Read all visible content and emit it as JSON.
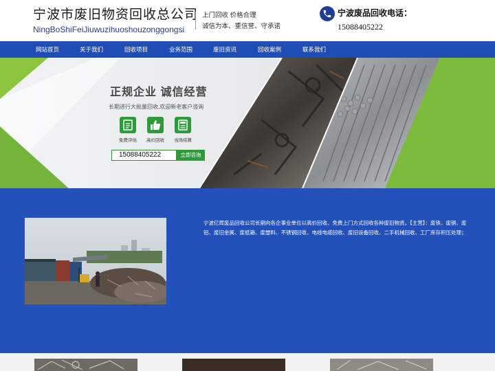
{
  "header": {
    "company_name": "宁波市废旧物资回收总公司",
    "company_pinyin": "NingBoShiFeiJiuwuzihuoshouzonggongsi",
    "slogan_line1": "上门回收 价格合理",
    "slogan_line2": "诚信为本、重信誉、守承诺",
    "hotline_label": "宁波废品回收电话：",
    "hotline_number": "15088405222"
  },
  "nav": {
    "items": [
      {
        "label": "网站首页"
      },
      {
        "label": "关于我们"
      },
      {
        "label": "回收项目"
      },
      {
        "label": "业务范围"
      },
      {
        "label": "废旧资讯"
      },
      {
        "label": "回收案例"
      },
      {
        "label": "联系我们"
      }
    ]
  },
  "banner": {
    "heading": "正规企业  诚信经营",
    "subheading": "长期进行大批量回收,欢迎新老客户咨询",
    "features": [
      {
        "label": "免费评估",
        "icon": "clipboard-icon"
      },
      {
        "label": "高价回收",
        "icon": "thumbs-up-icon"
      },
      {
        "label": "当场结算",
        "icon": "calculator-icon"
      }
    ],
    "phone_value": "15088405222",
    "consult_label": "立即咨询"
  },
  "about": {
    "description": "宁波亿辉废品回收公司长期向各企事业单位以高价回收、免费上门方式回收各种废旧物资。【主营】：废铁、废铜、废铝、废旧金属、废纸箱、废塑料、不锈钢回收、电线电缆回收、废旧设备回收、二手机械回收、工厂库存积压处理；"
  },
  "colors": {
    "brand_blue": "#1f4db4",
    "section_blue": "#2450b9",
    "accent_green": "#2e9b3a"
  }
}
